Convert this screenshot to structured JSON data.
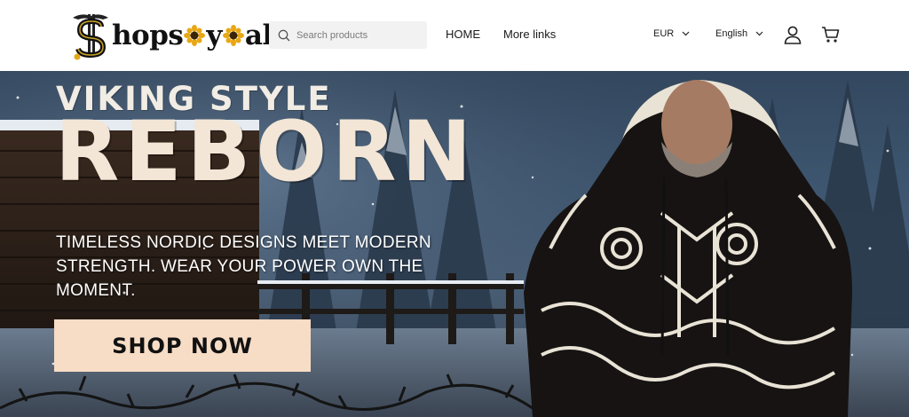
{
  "header": {
    "logo_text": "Shopsoyala",
    "search": {
      "placeholder": "Search products",
      "value": ""
    },
    "nav": [
      {
        "label": "HOME"
      },
      {
        "label": "More links"
      }
    ],
    "currency": {
      "selected": "EUR"
    },
    "language": {
      "selected": "English"
    }
  },
  "hero": {
    "headline_small": "VIKING STYLE",
    "headline_large": "REBORN",
    "description": "TIMELESS NORDIC DESIGNS MEET MODERN STRENGTH. WEAR YOUR POWER OWN THE MOMENT.",
    "cta_label": "SHOP NOW"
  },
  "colors": {
    "cta_background": "#f7dcc6",
    "headline": "#f3e6d6",
    "header_background": "#ffffff"
  },
  "icons": [
    "search-icon",
    "chevron-down-icon",
    "user-icon",
    "cart-icon",
    "valknut-logo-icon",
    "sunflower-icon"
  ]
}
